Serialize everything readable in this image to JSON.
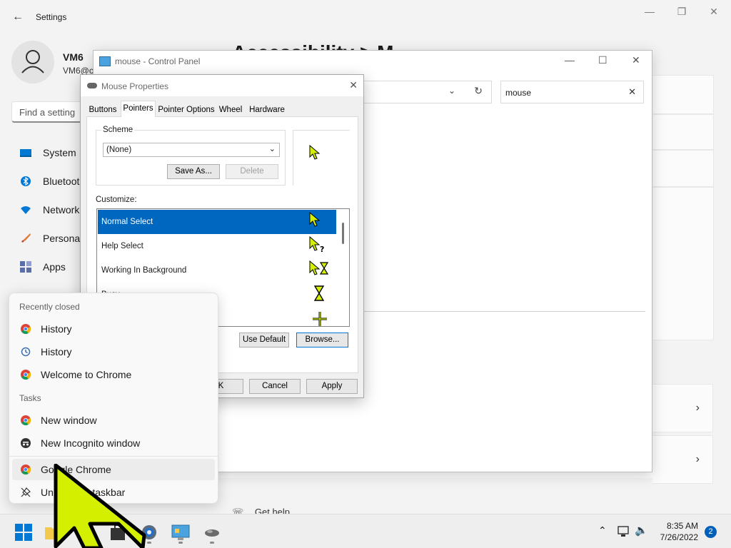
{
  "settings": {
    "window_title": "Settings",
    "profile_name": "VM6",
    "profile_email": "VM6@c",
    "search_placeholder": "Find a setting",
    "nav": [
      "System",
      "Bluetoot",
      "Network",
      "Personal",
      "Apps"
    ],
    "heading": "Accessibility > M",
    "get_help": "Get help"
  },
  "control_panel": {
    "title": "mouse - Control Panel",
    "search_value": "mouse"
  },
  "mouse_properties": {
    "title": "Mouse Properties",
    "tabs": [
      "Buttons",
      "Pointers",
      "Pointer Options",
      "Wheel",
      "Hardware"
    ],
    "active_tab": "Pointers",
    "scheme_label": "Scheme",
    "scheme_value": "(None)",
    "save_as": "Save As...",
    "delete": "Delete",
    "customize_label": "Customize:",
    "cursors": [
      "Normal Select",
      "Help Select",
      "Working In Background",
      "Busy"
    ],
    "use_default": "Use Default",
    "browse": "Browse...",
    "ok": "OK",
    "cancel": "Cancel",
    "apply": "Apply"
  },
  "jumplist": {
    "recently_closed_label": "Recently closed",
    "recently_closed": [
      "History",
      "History",
      "Welcome to Chrome"
    ],
    "tasks_label": "Tasks",
    "tasks": [
      "New window",
      "New Incognito window"
    ],
    "app_name": "Google Chrome",
    "unpin": "Unpin from taskbar"
  },
  "taskbar": {
    "time": "8:35 AM",
    "date": "7/26/2022",
    "notifications": "2"
  },
  "colors": {
    "accent": "#0067c0",
    "cursor_fill": "#d4f000",
    "cursor_outline": "#000000"
  }
}
